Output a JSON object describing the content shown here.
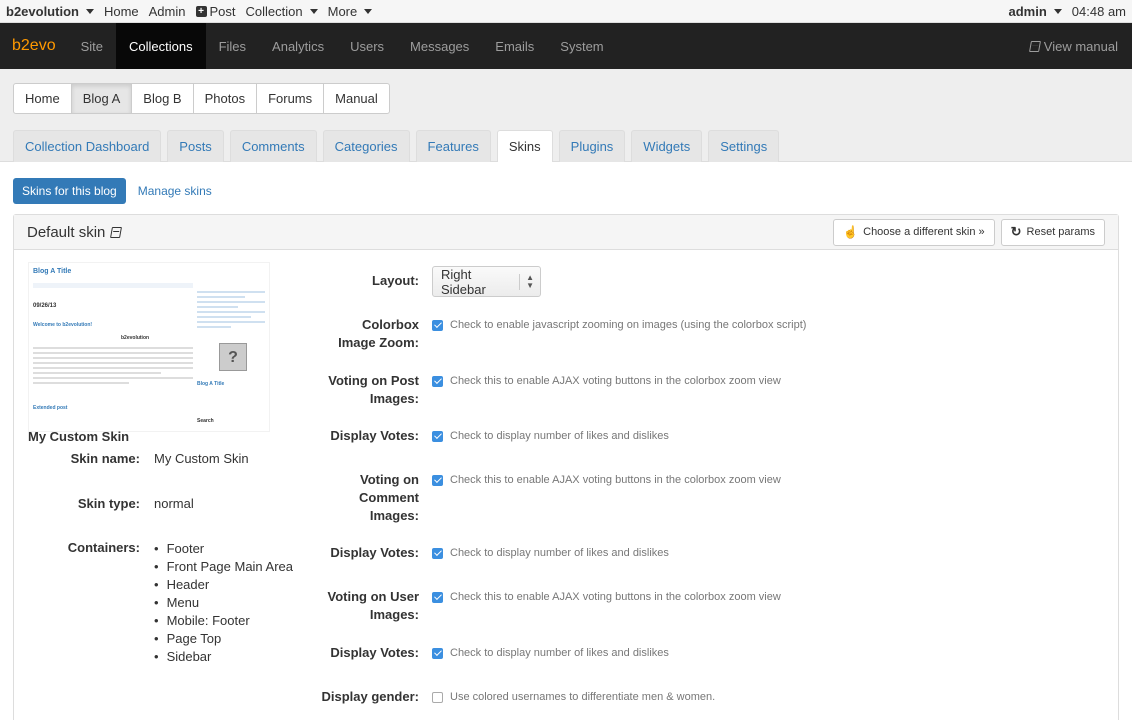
{
  "evobar": {
    "brand": "b2evolution",
    "home": "Home",
    "admin": "Admin",
    "post": "Post",
    "collection": "Collection",
    "more": "More",
    "user": "admin",
    "time": "04:48 am"
  },
  "navbar": {
    "logo": "b2evo",
    "items": [
      "Site",
      "Collections",
      "Files",
      "Analytics",
      "Users",
      "Messages",
      "Emails",
      "System"
    ],
    "active": "Collections",
    "manual": "View manual"
  },
  "collections": [
    "Home",
    "Blog A",
    "Blog B",
    "Photos",
    "Forums",
    "Manual"
  ],
  "active_collection": "Blog A",
  "subtabs": [
    "Collection Dashboard",
    "Posts",
    "Comments",
    "Categories",
    "Features",
    "Skins",
    "Plugins",
    "Widgets",
    "Settings"
  ],
  "active_subtab": "Skins",
  "pills": {
    "active": "Skins for this blog",
    "link": "Manage skins"
  },
  "panel": {
    "title": "Default skin",
    "choose_btn": "Choose a different skin »",
    "reset_btn": "Reset params"
  },
  "preview": {
    "blog_title": "Blog A Title",
    "date": "09/26/13",
    "welcome": "Welcome to b2evolution!",
    "logo": "b2evolution",
    "extended": "Extended post",
    "side_title": "Blog A Title",
    "search": "Search"
  },
  "skin": {
    "heading": "My Custom Skin",
    "name_label": "Skin name:",
    "name": "My Custom Skin",
    "type_label": "Skin type:",
    "type": "normal",
    "containers_label": "Containers:",
    "containers": [
      "Footer",
      "Front Page Main Area",
      "Header",
      "Menu",
      "Mobile: Footer",
      "Page Top",
      "Sidebar"
    ]
  },
  "form": {
    "layout_label": "Layout:",
    "layout_value": "Right Sidebar",
    "colorbox_label_1": "Colorbox",
    "colorbox_label_2": "Image Zoom:",
    "colorbox_text": "Check to enable javascript zooming on images (using the colorbox script)",
    "vote_post_label_1": "Voting on Post",
    "vote_post_label_2": "Images:",
    "vote_post_text": "Check this to enable AJAX voting buttons in the colorbox zoom view",
    "display_votes_label": "Display Votes:",
    "display_votes_text": "Check to display number of likes and dislikes",
    "vote_comment_label_1": "Voting on",
    "vote_comment_label_2": "Comment",
    "vote_comment_label_3": "Images:",
    "vote_comment_text": "Check this to enable AJAX voting buttons in the colorbox zoom view",
    "vote_user_label_1": "Voting on User",
    "vote_user_label_2": "Images:",
    "vote_user_text": "Check this to enable AJAX voting buttons in the colorbox zoom view",
    "gender_label": "Display gender:",
    "gender_text": "Use colored usernames to differentiate men & women."
  }
}
